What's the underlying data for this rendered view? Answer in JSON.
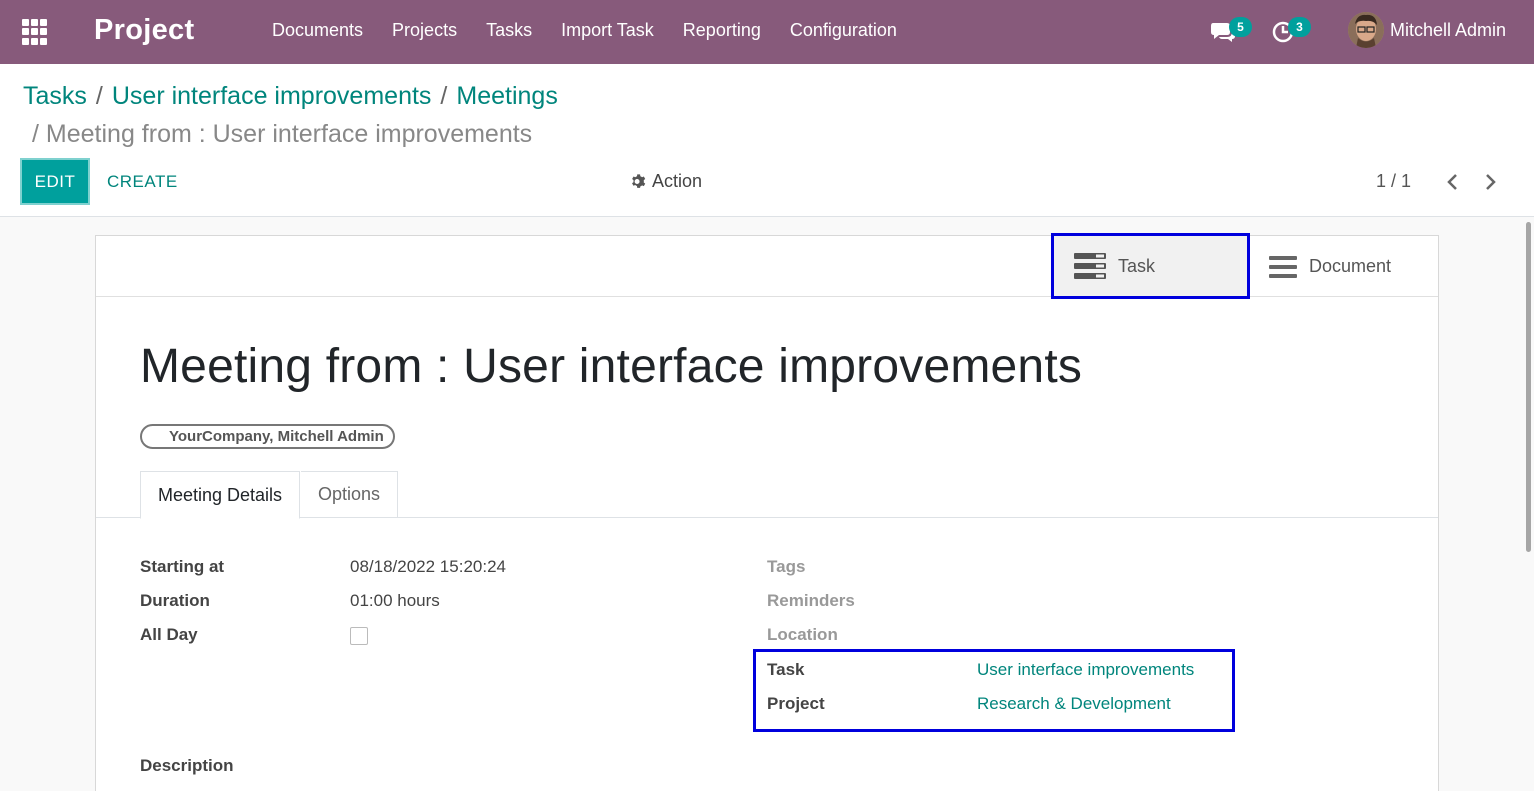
{
  "navbar": {
    "brand": "Project",
    "menu": [
      "Documents",
      "Projects",
      "Tasks",
      "Import Task",
      "Reporting",
      "Configuration"
    ],
    "chat_count": "5",
    "activity_count": "3",
    "user_name": "Mitchell Admin"
  },
  "breadcrumb": {
    "items": [
      "Tasks",
      "User interface improvements",
      "Meetings"
    ],
    "current": "Meeting from : User interface improvements",
    "separator": "/"
  },
  "toolbar": {
    "edit_label": "EDIT",
    "create_label": "CREATE",
    "action_label": "Action",
    "pager": "1 / 1"
  },
  "smart_buttons": {
    "task_label": "Task",
    "document_label": "Document"
  },
  "record": {
    "title": "Meeting from : User interface improvements",
    "attendees": "YourCompany, Mitchell Admin"
  },
  "tabs": [
    "Meeting Details",
    "Options"
  ],
  "fields": {
    "starting_at_label": "Starting at",
    "starting_at_value": "08/18/2022 15:20:24",
    "duration_label": "Duration",
    "duration_value": "01:00 hours",
    "all_day_label": "All Day",
    "tags_label": "Tags",
    "reminders_label": "Reminders",
    "location_label": "Location",
    "task_label": "Task",
    "task_value": "User interface improvements",
    "project_label": "Project",
    "project_value": "Research & Development",
    "description_label": "Description"
  },
  "colors": {
    "navbar": "#875a7b",
    "accent": "#00a09d",
    "link": "#00857c",
    "highlight": "#0000dd"
  }
}
